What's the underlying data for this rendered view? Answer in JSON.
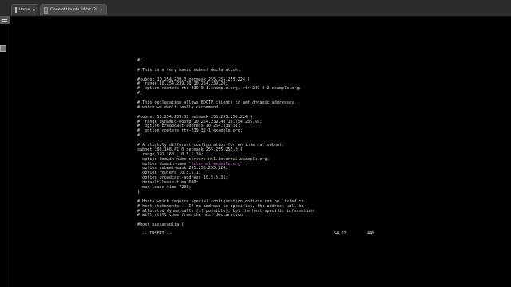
{
  "tabs": [
    {
      "label": "Home",
      "icon": "home-icon"
    },
    {
      "label": "Clone of Ubuntu 64-bit (2)",
      "icon": "vm-icon"
    }
  ],
  "terminal": {
    "lines": [
      {
        "parts": [
          {
            "t": "#}"
          }
        ]
      },
      {
        "parts": [
          {
            "t": ""
          }
        ]
      },
      {
        "parts": [
          {
            "t": "# This is a very basic subnet declaration."
          }
        ]
      },
      {
        "parts": [
          {
            "t": ""
          }
        ]
      },
      {
        "parts": [
          {
            "t": "#subnet 10.254.239.0 netmask 255.255.255.224 {"
          }
        ]
      },
      {
        "parts": [
          {
            "t": "#  range 10.254.239.10 10.254.239.20;"
          }
        ]
      },
      {
        "parts": [
          {
            "t": "#  option routers rtr-239-0-1.example.org, rtr-239-0-2.example.org;"
          }
        ]
      },
      {
        "parts": [
          {
            "t": "#}"
          }
        ]
      },
      {
        "parts": [
          {
            "t": ""
          }
        ]
      },
      {
        "parts": [
          {
            "t": "# This declaration allows BOOTP clients to get dynamic addresses,"
          }
        ]
      },
      {
        "parts": [
          {
            "t": "# which we don't really recommend."
          }
        ]
      },
      {
        "parts": [
          {
            "t": ""
          }
        ]
      },
      {
        "parts": [
          {
            "t": "#subnet 10.254.239.32 netmask 255.255.255.224 {"
          }
        ]
      },
      {
        "parts": [
          {
            "t": "#  range dynamic-bootp 10.254.239.40 10.254.239.60;"
          }
        ]
      },
      {
        "parts": [
          {
            "t": "#  option broadcast-address 10.254.239.31;"
          }
        ]
      },
      {
        "parts": [
          {
            "t": "#  option routers rtr-239-32-1.example.org;"
          }
        ]
      },
      {
        "parts": [
          {
            "t": "#}"
          }
        ]
      },
      {
        "parts": [
          {
            "t": ""
          }
        ]
      },
      {
        "parts": [
          {
            "t": "# A slightly different configuration for an internal subnet."
          }
        ]
      },
      {
        "parts": [
          {
            "t": "subnet 192.168.41.0 netmask 255.255.255.0 {"
          }
        ]
      },
      {
        "parts": [
          {
            "t": "  range 192.168._10.5.5.30;"
          }
        ]
      },
      {
        "parts": [
          {
            "t": "  option domain-name-servers ns1.internal.example.org;"
          }
        ]
      },
      {
        "parts": [
          {
            "t": "  option domain-name "
          },
          {
            "t": "\"internal.example.org\"",
            "hl": true
          },
          {
            "t": ";"
          }
        ]
      },
      {
        "parts": [
          {
            "t": "  option subnet-mask 255.255.255.224;"
          }
        ]
      },
      {
        "parts": [
          {
            "t": "  option routers 10.5.5.1;"
          }
        ]
      },
      {
        "parts": [
          {
            "t": "  option broadcast-address 10.5.5.31;"
          }
        ]
      },
      {
        "parts": [
          {
            "t": "  default-lease-time 600;"
          }
        ]
      },
      {
        "parts": [
          {
            "t": "  max-lease-time 7200;"
          }
        ]
      },
      {
        "parts": [
          {
            "t": "}"
          }
        ]
      },
      {
        "parts": [
          {
            "t": ""
          }
        ]
      },
      {
        "parts": [
          {
            "t": "# Hosts which require special configuration options can be listed in"
          }
        ]
      },
      {
        "parts": [
          {
            "t": "# host statements.   If no address is specified, the address will be"
          }
        ]
      },
      {
        "parts": [
          {
            "t": "# allocated dynamically (if possible), but the host-specific information"
          }
        ]
      },
      {
        "parts": [
          {
            "t": "# will still come from the host declaration."
          }
        ]
      },
      {
        "parts": [
          {
            "t": ""
          }
        ]
      },
      {
        "parts": [
          {
            "t": "#host passacaglia {"
          }
        ]
      }
    ]
  },
  "status": {
    "mode": "-- INSERT --",
    "position": "54,17",
    "percent": "44%"
  }
}
